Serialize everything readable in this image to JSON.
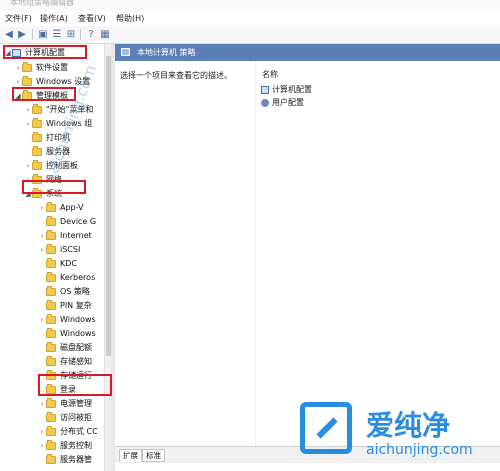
{
  "window": {
    "title": "本地组策略编辑器"
  },
  "menu": [
    "文件(F)",
    "操作(A)",
    "查看(V)",
    "帮助(H)"
  ],
  "toolbar": [
    "back-icon",
    "forward-icon",
    "folder-view-icon",
    "list-icon",
    "export-icon",
    "help-icon",
    "console-icon"
  ],
  "tree": {
    "items": [
      {
        "label": "计算机配置",
        "expanded": true,
        "highlighted": true
      },
      {
        "label": "软件设置",
        "expanded": false
      },
      {
        "label": "Windows 设置",
        "expanded": false
      },
      {
        "label": "管理模板",
        "expanded": true,
        "highlighted": true
      },
      {
        "label": "\"开始\"菜单和",
        "expanded": false
      },
      {
        "label": "Windows 组",
        "expanded": false
      },
      {
        "label": "打印机",
        "expanded": false
      },
      {
        "label": "服务器",
        "expanded": false
      },
      {
        "label": "控制面板",
        "expanded": false
      },
      {
        "label": "网络",
        "expanded": false
      },
      {
        "label": "系统",
        "expanded": true,
        "highlighted": true
      },
      {
        "label": "App-V",
        "expanded": false
      },
      {
        "label": "Device G",
        "expanded": false
      },
      {
        "label": "Internet",
        "expanded": false
      },
      {
        "label": "iSCSI",
        "expanded": false
      },
      {
        "label": "KDC",
        "expanded": false
      },
      {
        "label": "Kerberos",
        "expanded": false
      },
      {
        "label": "OS 策略",
        "expanded": false
      },
      {
        "label": "PIN 复杂",
        "expanded": false
      },
      {
        "label": "Windows",
        "expanded": false
      },
      {
        "label": "Windows",
        "expanded": false
      },
      {
        "label": "磁盘配额",
        "expanded": false
      },
      {
        "label": "存储感知",
        "expanded": false
      },
      {
        "label": "存储运行",
        "expanded": false
      },
      {
        "label": "登录",
        "expanded": false
      },
      {
        "label": "电源管理",
        "expanded": false,
        "highlighted": true
      },
      {
        "label": "访问被拒",
        "expanded": false
      },
      {
        "label": "分布式 CC",
        "expanded": false
      },
      {
        "label": "服务控制",
        "expanded": false
      },
      {
        "label": "服务器管",
        "expanded": false
      }
    ]
  },
  "right": {
    "header": "本地计算机 策略",
    "description": "选择一个项目来查看它的描述。",
    "column_name": "名称",
    "items": [
      "计算机配置",
      "用户配置"
    ]
  },
  "tabs": [
    "扩展",
    "标准"
  ],
  "watermark": {
    "brand": "爱纯净",
    "url": "aichunjing.com"
  },
  "colors": {
    "header": "#5b80b6",
    "highlight": "#d8192a",
    "watermark": "#2a8ee0"
  }
}
